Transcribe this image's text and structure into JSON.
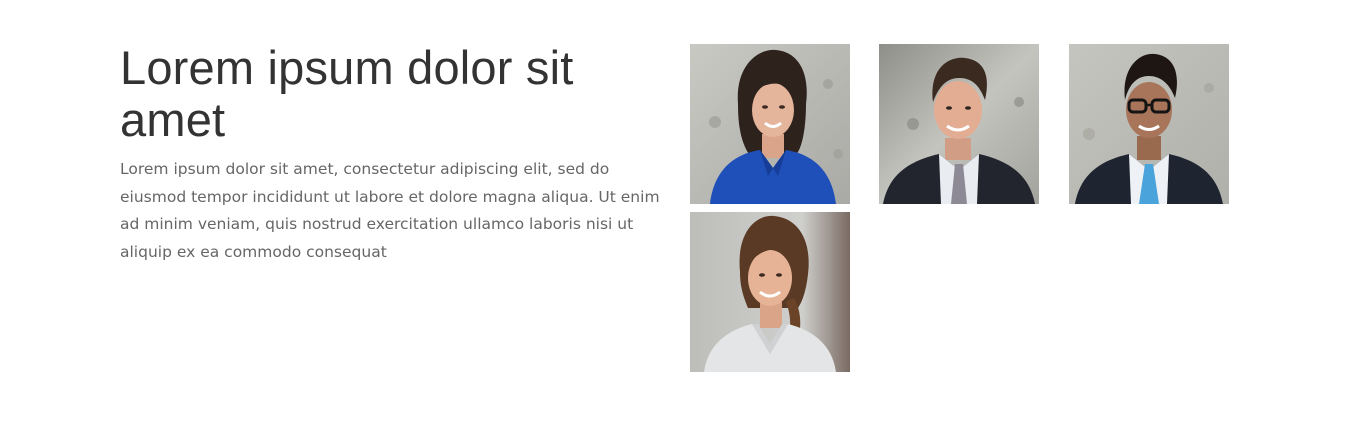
{
  "intro": {
    "heading": "Lorem ipsum dolor sit amet",
    "body": "Lorem ipsum dolor sit amet, consectetur adipiscing elit, sed do eiusmod tempor incididunt ut labore et dolore magna aliqua. Ut enim ad minim veniam, quis nostrud exercitation ullamco laboris nisi ut aliquip ex ea commodo consequat"
  },
  "team": {
    "members": [
      {
        "photo": "woman-blue-blouse-portrait"
      },
      {
        "photo": "man-suit-gray-tie-portrait"
      },
      {
        "photo": "man-glasses-blue-tie-portrait"
      },
      {
        "photo": "woman-braid-white-top-portrait"
      }
    ]
  },
  "colors": {
    "heading": "#333333",
    "body_text": "#666666",
    "background": "#ffffff"
  }
}
